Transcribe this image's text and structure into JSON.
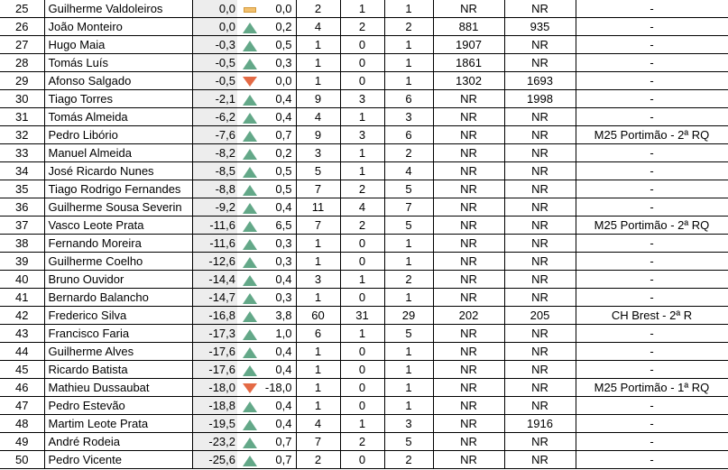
{
  "rows": [
    {
      "rank": "25",
      "name": "Guilherme Valdoleiros",
      "pts": "0,0",
      "trend": "flat",
      "var": "0,0",
      "a": "2",
      "b": "1",
      "c": "1",
      "d": "NR",
      "e": "NR",
      "note": "-"
    },
    {
      "rank": "26",
      "name": "João Monteiro",
      "pts": "0,0",
      "trend": "up",
      "var": "0,2",
      "a": "4",
      "b": "2",
      "c": "2",
      "d": "881",
      "e": "935",
      "note": "-"
    },
    {
      "rank": "27",
      "name": "Hugo Maia",
      "pts": "-0,3",
      "trend": "up",
      "var": "0,5",
      "a": "1",
      "b": "0",
      "c": "1",
      "d": "1907",
      "e": "NR",
      "note": "-"
    },
    {
      "rank": "28",
      "name": "Tomás Luís",
      "pts": "-0,5",
      "trend": "up",
      "var": "0,3",
      "a": "1",
      "b": "0",
      "c": "1",
      "d": "1861",
      "e": "NR",
      "note": "-"
    },
    {
      "rank": "29",
      "name": "Afonso Salgado",
      "pts": "-0,5",
      "trend": "down",
      "var": "0,0",
      "a": "1",
      "b": "0",
      "c": "1",
      "d": "1302",
      "e": "1693",
      "note": "-"
    },
    {
      "rank": "30",
      "name": "Tiago Torres",
      "pts": "-2,1",
      "trend": "up",
      "var": "0,4",
      "a": "9",
      "b": "3",
      "c": "6",
      "d": "NR",
      "e": "1998",
      "note": "-"
    },
    {
      "rank": "31",
      "name": "Tomás Almeida",
      "pts": "-6,2",
      "trend": "up",
      "var": "0,4",
      "a": "4",
      "b": "1",
      "c": "3",
      "d": "NR",
      "e": "NR",
      "note": "-"
    },
    {
      "rank": "32",
      "name": "Pedro Libório",
      "pts": "-7,6",
      "trend": "up",
      "var": "0,7",
      "a": "9",
      "b": "3",
      "c": "6",
      "d": "NR",
      "e": "NR",
      "note": "M25 Portimão - 2ª RQ"
    },
    {
      "rank": "33",
      "name": "Manuel Almeida",
      "pts": "-8,2",
      "trend": "up",
      "var": "0,2",
      "a": "3",
      "b": "1",
      "c": "2",
      "d": "NR",
      "e": "NR",
      "note": "-"
    },
    {
      "rank": "34",
      "name": "José Ricardo Nunes",
      "pts": "-8,5",
      "trend": "up",
      "var": "0,5",
      "a": "5",
      "b": "1",
      "c": "4",
      "d": "NR",
      "e": "NR",
      "note": "-"
    },
    {
      "rank": "35",
      "name": "Tiago Rodrigo Fernandes",
      "pts": "-8,8",
      "trend": "up",
      "var": "0,5",
      "a": "7",
      "b": "2",
      "c": "5",
      "d": "NR",
      "e": "NR",
      "note": "-"
    },
    {
      "rank": "36",
      "name": "Guilherme Sousa Severin",
      "pts": "-9,2",
      "trend": "up",
      "var": "0,4",
      "a": "11",
      "b": "4",
      "c": "7",
      "d": "NR",
      "e": "NR",
      "note": "-"
    },
    {
      "rank": "37",
      "name": "Vasco Leote Prata",
      "pts": "-11,6",
      "trend": "up",
      "var": "6,5",
      "a": "7",
      "b": "2",
      "c": "5",
      "d": "NR",
      "e": "NR",
      "note": "M25 Portimão - 2ª RQ"
    },
    {
      "rank": "38",
      "name": "Fernando Moreira",
      "pts": "-11,6",
      "trend": "up",
      "var": "0,3",
      "a": "1",
      "b": "0",
      "c": "1",
      "d": "NR",
      "e": "NR",
      "note": "-"
    },
    {
      "rank": "39",
      "name": "Guilherme Coelho",
      "pts": "-12,6",
      "trend": "up",
      "var": "0,3",
      "a": "1",
      "b": "0",
      "c": "1",
      "d": "NR",
      "e": "NR",
      "note": "-"
    },
    {
      "rank": "40",
      "name": "Bruno Ouvidor",
      "pts": "-14,4",
      "trend": "up",
      "var": "0,4",
      "a": "3",
      "b": "1",
      "c": "2",
      "d": "NR",
      "e": "NR",
      "note": "-"
    },
    {
      "rank": "41",
      "name": "Bernardo Balancho",
      "pts": "-14,7",
      "trend": "up",
      "var": "0,3",
      "a": "1",
      "b": "0",
      "c": "1",
      "d": "NR",
      "e": "NR",
      "note": "-"
    },
    {
      "rank": "42",
      "name": "Frederico Silva",
      "pts": "-16,8",
      "trend": "up",
      "var": "3,8",
      "a": "60",
      "b": "31",
      "c": "29",
      "d": "202",
      "e": "205",
      "note": "CH Brest - 2ª R"
    },
    {
      "rank": "43",
      "name": "Francisco Faria",
      "pts": "-17,3",
      "trend": "up",
      "var": "1,0",
      "a": "6",
      "b": "1",
      "c": "5",
      "d": "NR",
      "e": "NR",
      "note": "-"
    },
    {
      "rank": "44",
      "name": "Guilherme Alves",
      "pts": "-17,6",
      "trend": "up",
      "var": "0,4",
      "a": "1",
      "b": "0",
      "c": "1",
      "d": "NR",
      "e": "NR",
      "note": "-"
    },
    {
      "rank": "45",
      "name": "Ricardo Batista",
      "pts": "-17,6",
      "trend": "up",
      "var": "0,4",
      "a": "1",
      "b": "0",
      "c": "1",
      "d": "NR",
      "e": "NR",
      "note": "-"
    },
    {
      "rank": "46",
      "name": "Mathieu Dussaubat",
      "pts": "-18,0",
      "trend": "down",
      "var": "-18,0",
      "a": "1",
      "b": "0",
      "c": "1",
      "d": "NR",
      "e": "NR",
      "note": "M25 Portimão - 1ª RQ"
    },
    {
      "rank": "47",
      "name": "Pedro Estevão",
      "pts": "-18,8",
      "trend": "up",
      "var": "0,4",
      "a": "1",
      "b": "0",
      "c": "1",
      "d": "NR",
      "e": "NR",
      "note": "-"
    },
    {
      "rank": "48",
      "name": "Martim Leote Prata",
      "pts": "-19,5",
      "trend": "up",
      "var": "0,4",
      "a": "4",
      "b": "1",
      "c": "3",
      "d": "NR",
      "e": "1916",
      "note": "-"
    },
    {
      "rank": "49",
      "name": "André Rodeia",
      "pts": "-23,2",
      "trend": "up",
      "var": "0,7",
      "a": "7",
      "b": "2",
      "c": "5",
      "d": "NR",
      "e": "NR",
      "note": "-"
    },
    {
      "rank": "50",
      "name": "Pedro Vicente",
      "pts": "-25,6",
      "trend": "up",
      "var": "0,7",
      "a": "2",
      "b": "0",
      "c": "2",
      "d": "NR",
      "e": "NR",
      "note": "-"
    }
  ],
  "trend_colors": {
    "up": "#63a888",
    "down": "#e46a45",
    "flat": "#f2c06e"
  }
}
